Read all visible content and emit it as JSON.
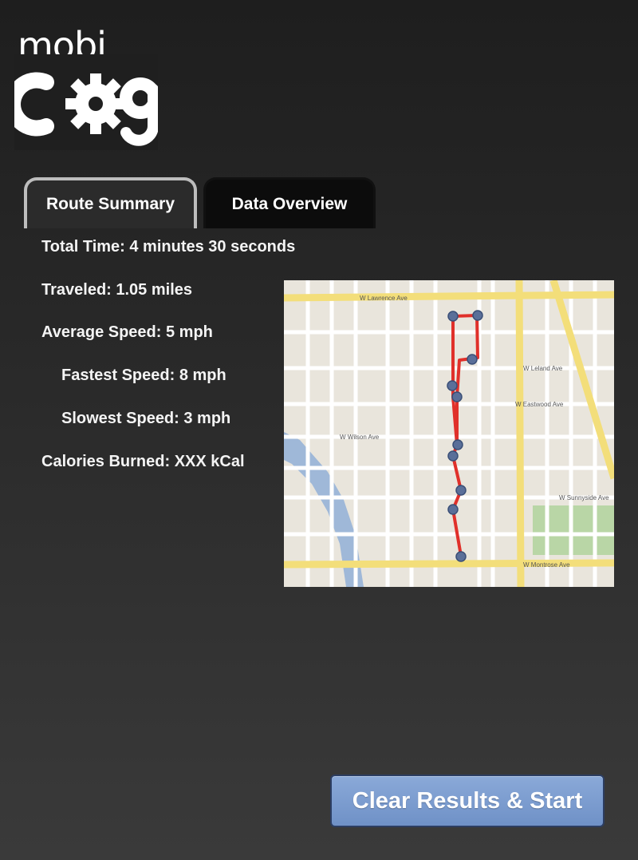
{
  "app": {
    "logo_text": "mobicog"
  },
  "tabs": [
    {
      "label": "Route Summary",
      "active": true
    },
    {
      "label": "Data Overview",
      "active": false
    }
  ],
  "summary": {
    "total_time": "Total Time: 4 minutes 30 seconds",
    "traveled": "Traveled: 1.05 miles",
    "average_speed": "Average Speed: 5 mph",
    "fastest_speed": "Fastest Speed: 8 mph",
    "slowest_speed": "Slowest Speed: 3 mph",
    "calories": "Calories Burned: XXX kCal"
  },
  "map": {
    "streets": [
      "W Lawrence Ave",
      "W Leland Ave",
      "W Eastwood Ave",
      "W Wilson Ave",
      "W Sunnyside Ave",
      "W Montrose Ave"
    ],
    "route_color": "#e0302a",
    "waypoint_color": "#5a6f99"
  },
  "actions": {
    "clear_label": "Clear Results & Start"
  },
  "colors": {
    "button_bg": "#7a9bd0",
    "tab_active_border": "#bdbdbd"
  }
}
